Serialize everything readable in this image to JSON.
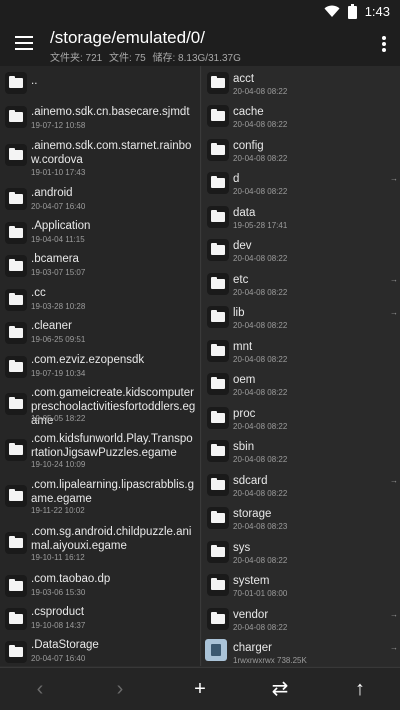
{
  "status_bar": {
    "time": "1:43"
  },
  "header": {
    "path": "/storage/emulated/0/",
    "folders_label": "文件夹: 721",
    "files_label": "文件: 75",
    "storage_label": "储存: 8.13G/31.37G"
  },
  "left_list": [
    {
      "name": "..",
      "date": ""
    },
    {
      "name": ".ainemo.sdk.cn.basecare.sjmdt",
      "date": "19-07-12 10:58"
    },
    {
      "name": ".ainemo.sdk.com.starnet.rainbow.cordova",
      "date": "19-01-10 17:43"
    },
    {
      "name": ".android",
      "date": "20-04-07 16:40"
    },
    {
      "name": ".Application",
      "date": "19-04-04 11:15"
    },
    {
      "name": ".bcamera",
      "date": "19-03-07 15:07"
    },
    {
      "name": ".cc",
      "date": "19-03-28 10:28"
    },
    {
      "name": ".cleaner",
      "date": "19-06-25 09:51"
    },
    {
      "name": ".com.ezviz.ezopensdk",
      "date": "19-07-19 10:34"
    },
    {
      "name": ".com.gameicreate.kidscomputerpreschoolactivitiesfortoddlers.egame",
      "date": "19-05-05 18:22"
    },
    {
      "name": ".com.kidsfunworld.Play.TransportationJigsawPuzzles.egame",
      "date": "19-10-24 10:09"
    },
    {
      "name": ".com.lipalearning.lipascrabblis.game.egame",
      "date": "19-11-22 10:02"
    },
    {
      "name": ".com.sg.android.childpuzzle.animal.aiyouxi.egame",
      "date": "19-10-11 16:12"
    },
    {
      "name": ".com.taobao.dp",
      "date": "19-03-06 15:30"
    },
    {
      "name": ".csproduct",
      "date": "19-10-08 14:37"
    },
    {
      "name": ".DataStorage",
      "date": "20-04-07 16:40"
    }
  ],
  "right_list": [
    {
      "name": "acct",
      "date": "20-04-08 08:22",
      "arrow": ""
    },
    {
      "name": "cache",
      "date": "20-04-08 08:22",
      "arrow": ""
    },
    {
      "name": "config",
      "date": "20-04-08 08:22",
      "arrow": ""
    },
    {
      "name": "d",
      "date": "20-04-08 08:22",
      "arrow": "→"
    },
    {
      "name": "data",
      "date": "19-05-28 17:41",
      "arrow": ""
    },
    {
      "name": "dev",
      "date": "20-04-08 08:22",
      "arrow": ""
    },
    {
      "name": "etc",
      "date": "20-04-08 08:22",
      "arrow": "→"
    },
    {
      "name": "lib",
      "date": "20-04-08 08:22",
      "arrow": "→"
    },
    {
      "name": "mnt",
      "date": "20-04-08 08:22",
      "arrow": ""
    },
    {
      "name": "oem",
      "date": "20-04-08 08:22",
      "arrow": ""
    },
    {
      "name": "proc",
      "date": "20-04-08 08:22",
      "arrow": ""
    },
    {
      "name": "sbin",
      "date": "20-04-08 08:22",
      "arrow": ""
    },
    {
      "name": "sdcard",
      "date": "20-04-08 08:22",
      "arrow": "→"
    },
    {
      "name": "storage",
      "date": "20-04-08 08:23",
      "arrow": ""
    },
    {
      "name": "sys",
      "date": "20-04-08 08:22",
      "arrow": ""
    },
    {
      "name": "system",
      "date": "70-01-01 08:00",
      "arrow": ""
    },
    {
      "name": "vendor",
      "date": "20-04-08 08:22",
      "arrow": "→"
    },
    {
      "name": "charger",
      "date": "1rwxrwxrwx  738.25K",
      "arrow": "→",
      "type": "file"
    }
  ],
  "bottom_bar": {
    "back": "‹",
    "forward": "›",
    "add": "+",
    "swap": "⇄",
    "up": "↑"
  },
  "icons": {
    "status": [
      "wifi-icon",
      "battery-icon"
    ],
    "menu": "menu-icon",
    "more": "more-vert-icon",
    "folder": "folder-icon",
    "file": "file-icon"
  }
}
